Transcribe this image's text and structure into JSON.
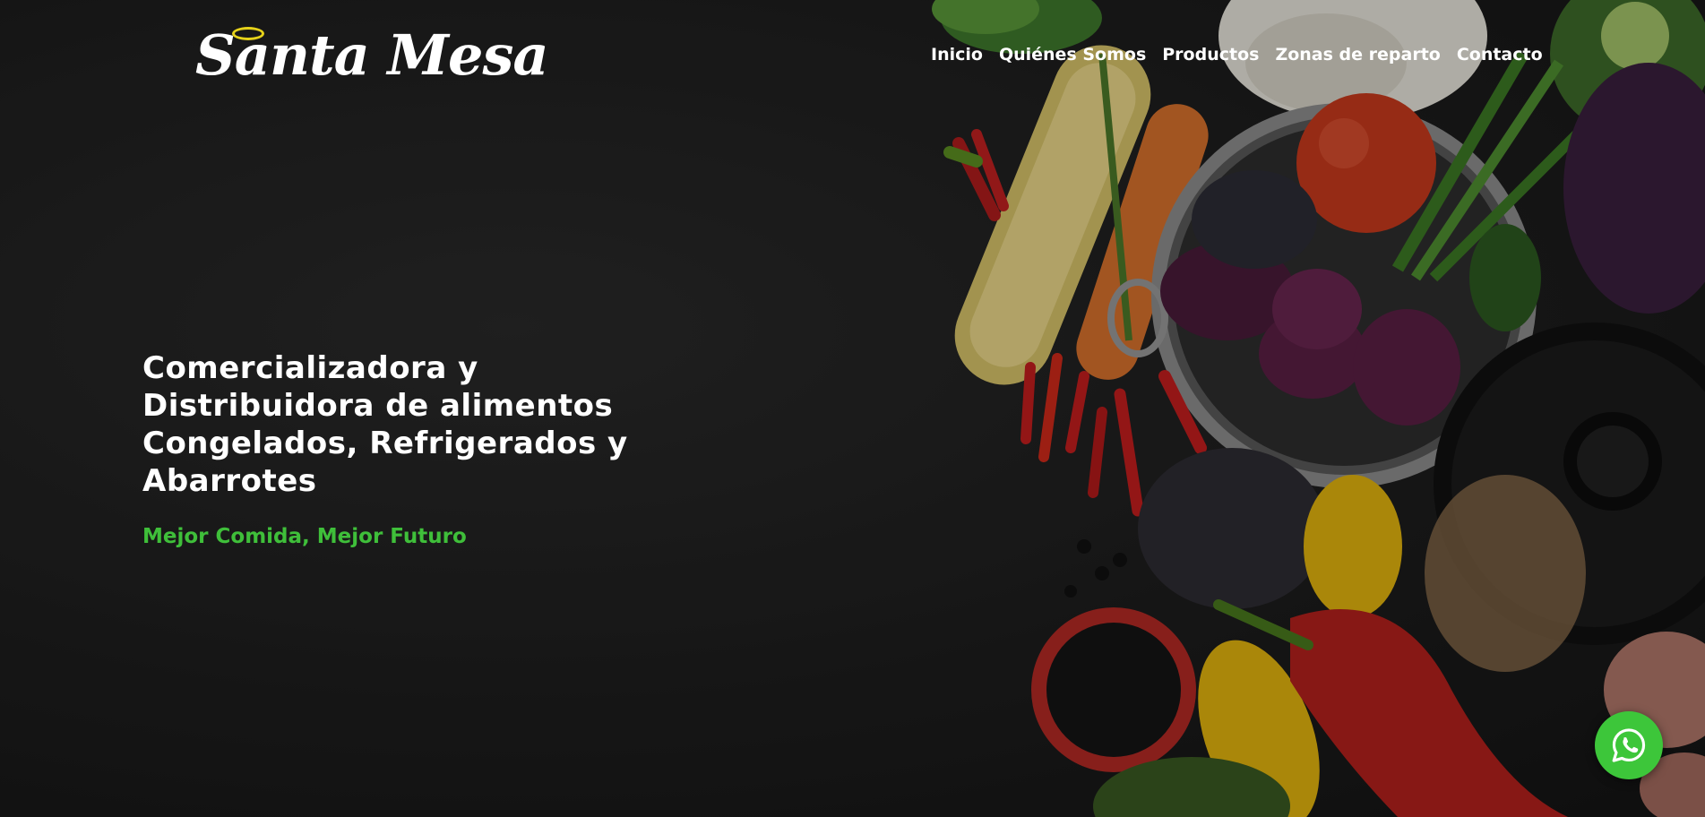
{
  "brand": {
    "name": "Santa Mesa"
  },
  "nav": [
    {
      "label": "Inicio"
    },
    {
      "label": "Quiénes Somos"
    },
    {
      "label": "Productos"
    },
    {
      "label": "Zonas de reparto"
    },
    {
      "label": "Contacto"
    }
  ],
  "hero": {
    "headline": "Comercializadora y Distribuidora de alimentos Congelados, Refrigerados y Abarrotes",
    "tagline": "Mejor Comida, Mejor Futuro"
  },
  "colors": {
    "accent": "#3fbf3a",
    "whatsapp": "#3dc63a",
    "background": "#1f1f1f"
  },
  "icons": [
    "whatsapp-icon"
  ]
}
